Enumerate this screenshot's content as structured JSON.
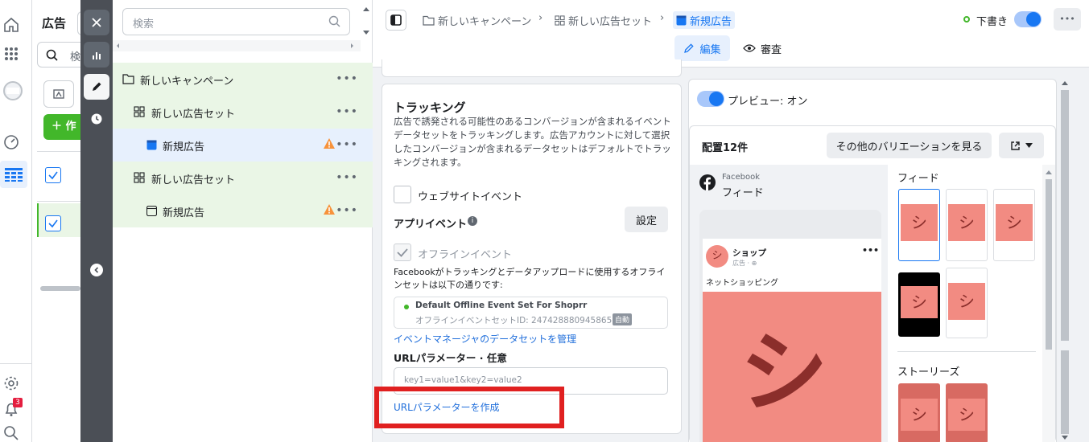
{
  "app": {
    "title": "広告",
    "search_placeholder": "検"
  },
  "left_panel": {
    "create_label": "＋ 作"
  },
  "tree": {
    "search_placeholder": "検索",
    "items": [
      {
        "label": "新しいキャンペーン",
        "kind": "campaign",
        "warn": false
      },
      {
        "label": "新しい広告セット",
        "kind": "adset",
        "warn": false
      },
      {
        "label": "新規広告",
        "kind": "ad",
        "warn": true,
        "selected": true
      },
      {
        "label": "新しい広告セット",
        "kind": "adset",
        "warn": false
      },
      {
        "label": "新規広告",
        "kind": "ad",
        "warn": true
      }
    ],
    "more": "•••"
  },
  "header": {
    "crumbs": [
      "新しいキャンペーン",
      "新しい広告セット",
      "新規広告"
    ],
    "draft": "下書き",
    "more": "•••",
    "tab_edit": "編集",
    "tab_review": "審査"
  },
  "tracking": {
    "title": "トラッキング",
    "desc": "広告で誘発される可能性のあるコンバージョンが含まれるイベントデータセットをトラッキングします。広告アカウントに対して選択したコンバージョンが含まれるデータセットはデフォルトでトラッキングされます。",
    "website_events": "ウェブサイトイベント",
    "app_events": "アプリイベント",
    "settings": "設定",
    "offline_events": "オフラインイベント",
    "offline_desc": "Facebookがトラッキングとデータアップロードに使用するオフラインセットは以下の通りです:",
    "event_set_name": "Default Offline Event Set For Shoprr",
    "event_set_id": "オフラインイベントセットID: 2474288809458656",
    "auto_badge": "自動",
    "manage_link": "イベントマネージャのデータセットを管理",
    "url_params_label": "URLパラメーター · 任意",
    "url_params_placeholder": "key1=value1&key2=value2",
    "build_url_link": "URLパラメーターを作成"
  },
  "preview": {
    "toggle_label": "プレビュー: オン",
    "placements": "配置12件",
    "variations_btn": "その他のバリエーションを見る",
    "fb_label": "Facebook",
    "feed_label": "フィード",
    "shop_name": "ショップ",
    "shop_sub": "広告 · ⊕",
    "shop_text": "ネットショッピング",
    "shop_glyph": "シ",
    "feed_section": "フィード",
    "stories_section": "ストーリーズ"
  },
  "colors": {
    "accent": "#1877f2",
    "highlight": "#e02020",
    "pink": "#f28b82"
  }
}
